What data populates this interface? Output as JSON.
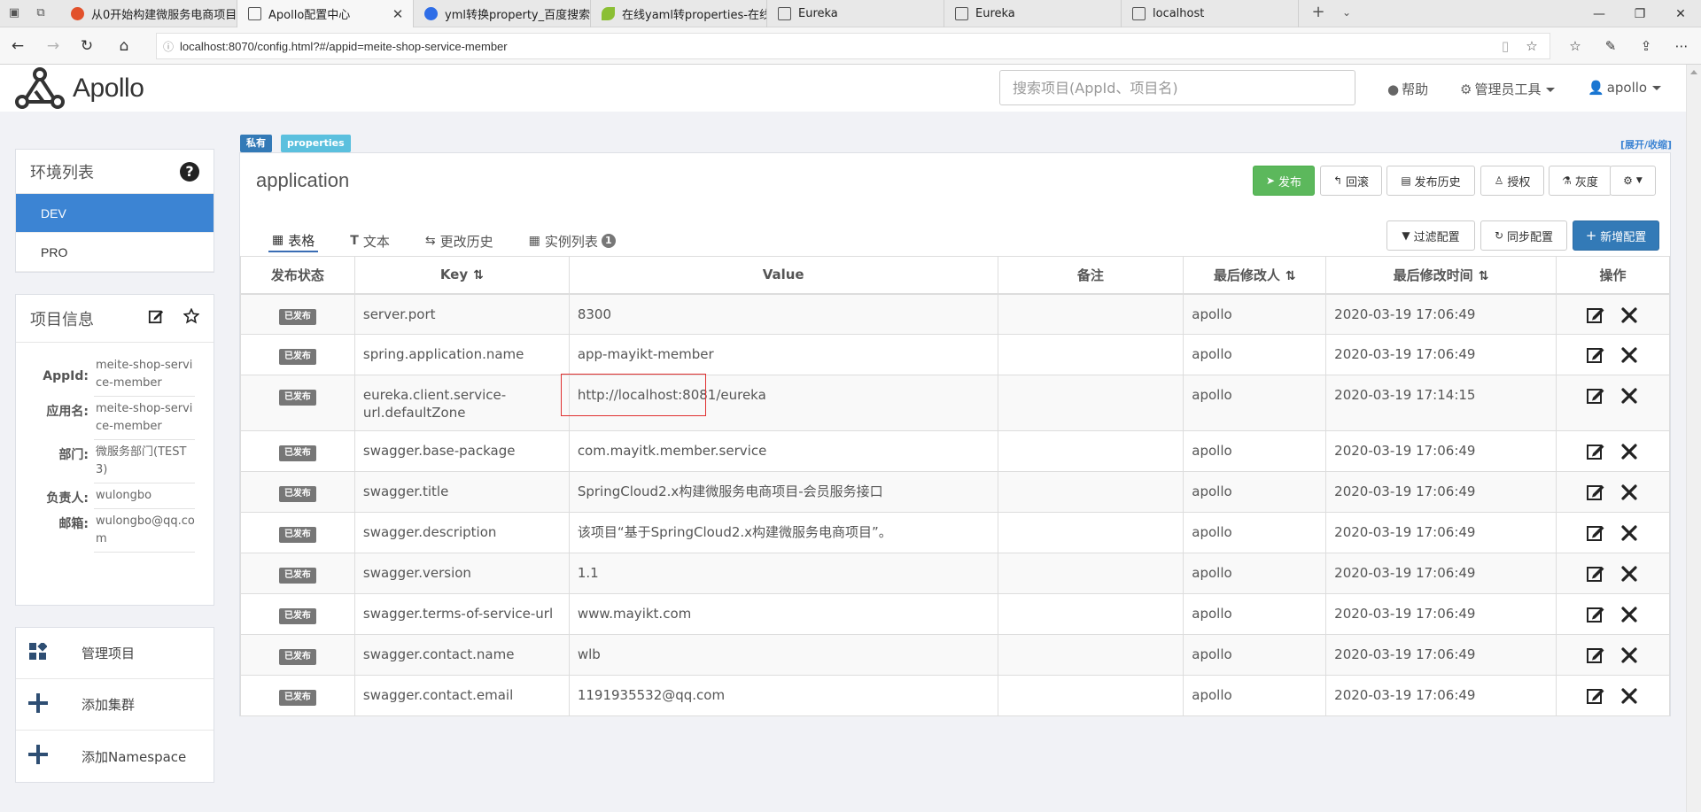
{
  "browser": {
    "tabs": [
      {
        "label": "从0开始构建微服务电商项目",
        "favicon": "csdn",
        "active": false
      },
      {
        "label": "Apollo配置中心",
        "favicon": "page",
        "active": true
      },
      {
        "label": "yml转换property_百度搜索",
        "favicon": "baidu",
        "active": false
      },
      {
        "label": "在线yaml转properties-在线",
        "favicon": "leaf",
        "active": false
      },
      {
        "label": "Eureka",
        "favicon": "page",
        "active": false
      },
      {
        "label": "Eureka",
        "favicon": "page",
        "active": false
      },
      {
        "label": "localhost",
        "favicon": "page",
        "active": false
      }
    ],
    "url": "localhost:8070/config.html?#/appid=meite-shop-service-member"
  },
  "header": {
    "logo_text": "Apollo",
    "search_placeholder": "搜索项目(AppId、项目名)",
    "help": "帮助",
    "admin_tools": "管理员工具",
    "user": "apollo"
  },
  "sidebar": {
    "env_title": "环境列表",
    "envs": [
      "DEV",
      "PRO"
    ],
    "active_env": "DEV",
    "project_title": "项目信息",
    "project_info": [
      {
        "key": "AppId:",
        "value": "meite-shop-service-member"
      },
      {
        "key": "应用名:",
        "value": "meite-shop-service-member"
      },
      {
        "key": "部门:",
        "value": "微服务部门(TEST3)"
      },
      {
        "key": "负责人:",
        "value": "wulongbo"
      },
      {
        "key": "邮箱:",
        "value": "wulongbo@qq.com"
      }
    ],
    "actions": [
      "管理项目",
      "添加集群",
      "添加Namespace"
    ]
  },
  "namespace": {
    "scope_label": "私有",
    "format_label": "properties",
    "expand_link": "[展开/收缩]",
    "name": "application",
    "buttons": {
      "publish": "发布",
      "rollback": "回滚",
      "history": "发布历史",
      "grant": "授权",
      "gray": "灰度"
    },
    "tabs": [
      {
        "label": "表格",
        "active": true
      },
      {
        "label": "文本",
        "active": false
      },
      {
        "label": "更改历史",
        "active": false
      },
      {
        "label": "实例列表",
        "active": false,
        "badge": "1"
      }
    ],
    "tools": {
      "filter": "过滤配置",
      "sync": "同步配置",
      "add": "新增配置"
    },
    "columns": [
      "发布状态",
      "Key",
      "Value",
      "备注",
      "最后修改人",
      "最后修改时间",
      "操作"
    ],
    "rows": [
      {
        "status": "已发布",
        "key": "server.port",
        "value": "8300",
        "comment": "",
        "modifier": "apollo",
        "time": "2020-03-19 17:06:49"
      },
      {
        "status": "已发布",
        "key": "spring.application.name",
        "value": "app-mayikt-member",
        "comment": "",
        "modifier": "apollo",
        "time": "2020-03-19 17:06:49"
      },
      {
        "status": "已发布",
        "key": "eureka.client.service-url.defaultZone",
        "value": "http://localhost:8081/eureka",
        "comment": "",
        "modifier": "apollo",
        "time": "2020-03-19 17:14:15"
      },
      {
        "status": "已发布",
        "key": "swagger.base-package",
        "value": "com.mayitk.member.service",
        "comment": "",
        "modifier": "apollo",
        "time": "2020-03-19 17:06:49"
      },
      {
        "status": "已发布",
        "key": "swagger.title",
        "value": "SpringCloud2.x构建微服务电商项目-会员服务接口",
        "comment": "",
        "modifier": "apollo",
        "time": "2020-03-19 17:06:49"
      },
      {
        "status": "已发布",
        "key": "swagger.description",
        "value": "该项目“基于SpringCloud2.x构建微服务电商项目”。",
        "comment": "",
        "modifier": "apollo",
        "time": "2020-03-19 17:06:49"
      },
      {
        "status": "已发布",
        "key": "swagger.version",
        "value": "1.1",
        "comment": "",
        "modifier": "apollo",
        "time": "2020-03-19 17:06:49"
      },
      {
        "status": "已发布",
        "key": "swagger.terms-of-service-url",
        "value": "www.mayikt.com",
        "comment": "",
        "modifier": "apollo",
        "time": "2020-03-19 17:06:49"
      },
      {
        "status": "已发布",
        "key": "swagger.contact.name",
        "value": "wlb",
        "comment": "",
        "modifier": "apollo",
        "time": "2020-03-19 17:06:49"
      },
      {
        "status": "已发布",
        "key": "swagger.contact.email",
        "value": "1191935532@qq.com",
        "comment": "",
        "modifier": "apollo",
        "time": "2020-03-19 17:06:49"
      }
    ]
  },
  "colors": {
    "primary": "#337ab7",
    "success": "#5cb85c",
    "active_env": "#3c84d3",
    "label_private": "#337ab7",
    "label_format": "#5bc0de",
    "published": "#777777",
    "highlight_box": "#e03030"
  }
}
